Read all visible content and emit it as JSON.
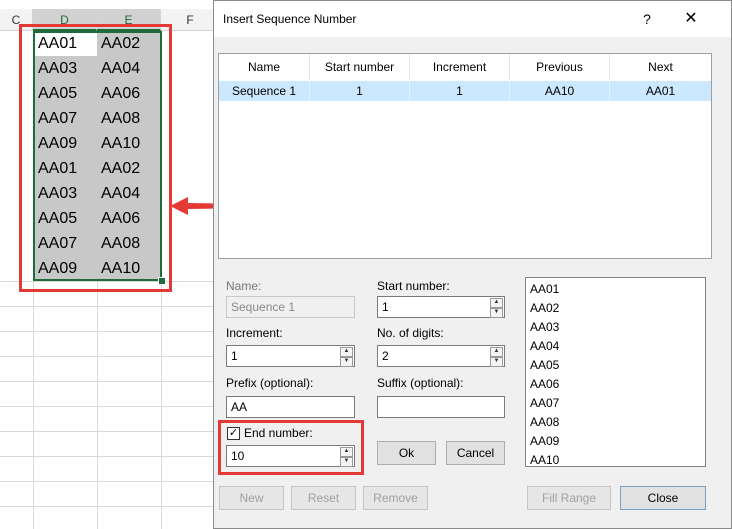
{
  "sheet": {
    "columns": [
      "C",
      "D",
      "E",
      "F"
    ],
    "rows": [
      [
        "AA01",
        "AA02"
      ],
      [
        "AA03",
        "AA04"
      ],
      [
        "AA05",
        "AA06"
      ],
      [
        "AA07",
        "AA08"
      ],
      [
        "AA09",
        "AA10"
      ],
      [
        "AA01",
        "AA02"
      ],
      [
        "AA03",
        "AA04"
      ],
      [
        "AA05",
        "AA06"
      ],
      [
        "AA07",
        "AA08"
      ],
      [
        "AA09",
        "AA10"
      ]
    ]
  },
  "dialog": {
    "title": "Insert Sequence Number",
    "help": "?",
    "close_glyph": "✕",
    "table": {
      "headers": [
        "Name",
        "Start number",
        "Increment",
        "Previous",
        "Next"
      ],
      "rows": [
        [
          "Sequence 1",
          "1",
          "1",
          "AA10",
          "AA01"
        ]
      ]
    },
    "form": {
      "name_label": "Name:",
      "name_value": "Sequence 1",
      "start_label": "Start number:",
      "start_value": "1",
      "increment_label": "Increment:",
      "increment_value": "1",
      "digits_label": "No. of digits:",
      "digits_value": "2",
      "prefix_label": "Prefix (optional):",
      "prefix_value": "AA",
      "suffix_label": "Suffix (optional):",
      "suffix_value": "",
      "end_label": "End number:",
      "end_checked": true,
      "end_value": "10"
    },
    "preview": [
      "AA01",
      "AA02",
      "AA03",
      "AA04",
      "AA05",
      "AA06",
      "AA07",
      "AA08",
      "AA09",
      "AA10"
    ],
    "buttons": {
      "ok": "Ok",
      "cancel": "Cancel",
      "new": "New",
      "reset": "Reset",
      "remove": "Remove",
      "fill_range": "Fill Range",
      "close": "Close"
    }
  },
  "colors": {
    "highlight_red": "#e53935",
    "selection_green": "#1e6b3b",
    "row_selected": "#cce8ff"
  }
}
